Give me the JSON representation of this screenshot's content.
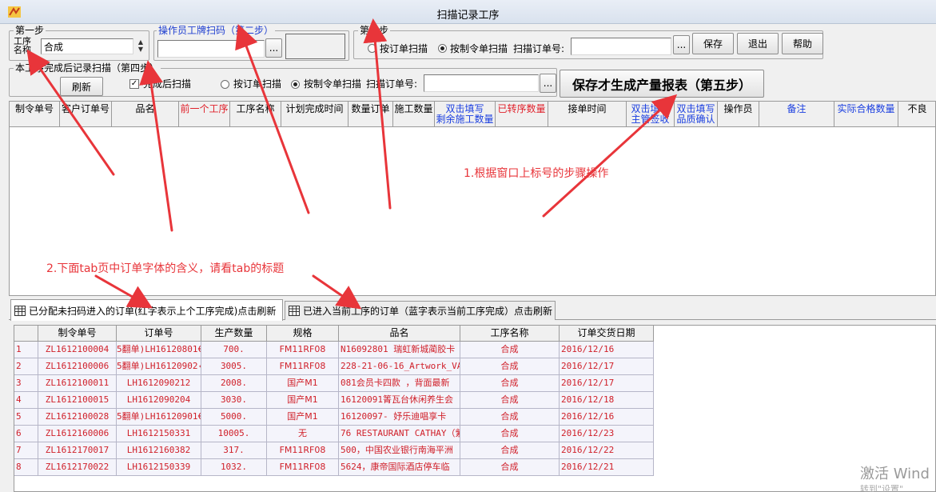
{
  "window": {
    "title": "扫描记录工序"
  },
  "step1": {
    "legend": "第一步",
    "process_label": "工序\n名称",
    "process_value": "合成"
  },
  "step2": {
    "legend": "操作员工牌扫码（第二步）",
    "browse": "..."
  },
  "step3": {
    "legend": "第三步",
    "radio_order": "按订单扫描",
    "radio_cmd": "按制令单扫描",
    "scan_label": "扫描订单号:",
    "browse": "...",
    "save": "保存",
    "exit": "退出",
    "help": "帮助"
  },
  "step4": {
    "legend": "本工序完成后记录扫描（第四步）",
    "refresh": "刷新",
    "check_after": "完成后扫描",
    "radio_order": "按订单扫描",
    "radio_cmd": "按制令单扫描",
    "scan_label": "扫描订单号:",
    "browse": "..."
  },
  "step5": {
    "save_report": "保存才生成产量报表（第五步）"
  },
  "top_grid": {
    "columns": [
      {
        "label": "制令单号",
        "color": "black"
      },
      {
        "label": "客户订单号",
        "color": "black"
      },
      {
        "label": "品名",
        "color": "black"
      },
      {
        "label": "前一个工序",
        "color": "red"
      },
      {
        "label": "工序名称",
        "color": "black"
      },
      {
        "label": "计划完成时间",
        "color": "black"
      },
      {
        "label": "数量订单",
        "color": "black"
      },
      {
        "label": "施工数量",
        "color": "black"
      },
      {
        "label": "双击填写\n剩余施工数量",
        "color": "blue"
      },
      {
        "label": "已转序数量",
        "color": "red"
      },
      {
        "label": "接单时间",
        "color": "black"
      },
      {
        "label": "双击填写\n主管签收",
        "color": "blue"
      },
      {
        "label": "双击填写\n品质确认",
        "color": "blue"
      },
      {
        "label": "操作员",
        "color": "black"
      },
      {
        "label": "备注",
        "color": "blue"
      },
      {
        "label": "实际合格数量",
        "color": "blue"
      },
      {
        "label": "不良",
        "color": "black"
      }
    ]
  },
  "notes": {
    "note1": "1.根据窗口上标号的步骤操作",
    "note2": "2.下面tab页中订单字体的含义，请看tab的标题"
  },
  "tabs": [
    {
      "label": "已分配未扫码进入的订单(红字表示上个工序完成)点击刷新",
      "active": true
    },
    {
      "label": "已进入当前工序的订单（蓝字表示当前工序完成）点击刷新",
      "active": false
    }
  ],
  "bottom_grid": {
    "columns": [
      "制令单号",
      "订单号",
      "生产数量",
      "规格",
      "品名",
      "工序名称",
      "订单交货日期"
    ],
    "rows": [
      {
        "idx": "1",
        "cmd": "ZL1612100004",
        "order": "5翻单)LH16120801€",
        "qty": "700.",
        "spec": "FM11RF08",
        "name": "N16092801 瑞虹新城蔺胶卡",
        "process": "合成",
        "date": "2016/12/16"
      },
      {
        "idx": "2",
        "cmd": "ZL1612100006",
        "order": "5翻单)LH16120902‹",
        "qty": "3005.",
        "spec": "FM11RF08",
        "name": "228-21-06-16_Artwork_VAGA",
        "process": "合成",
        "date": "2016/12/17"
      },
      {
        "idx": "3",
        "cmd": "ZL1612100011",
        "order": "LH1612090212",
        "qty": "2008.",
        "spec": "国产M1",
        "name": "081会员卡四款 ，背面最新",
        "process": "合成",
        "date": "2016/12/17"
      },
      {
        "idx": "4",
        "cmd": "ZL1612100015",
        "order": "LH1612090204",
        "qty": "3030.",
        "spec": "国产M1",
        "name": "16120091箐瓦台休闲养生会",
        "process": "合成",
        "date": "2016/12/18"
      },
      {
        "idx": "5",
        "cmd": "ZL1612100028",
        "order": "5翻单)LH16120901€",
        "qty": "5000.",
        "spec": "国产M1",
        "name": "16120097- 妤乐迪唱享卡",
        "process": "合成",
        "date": "2016/12/16"
      },
      {
        "idx": "6",
        "cmd": "ZL1612160006",
        "order": "LH1612150331",
        "qty": "10005.",
        "spec": "无",
        "name": "76 RESTAURANT CATHAY（紫",
        "process": "合成",
        "date": "2016/12/23"
      },
      {
        "idx": "7",
        "cmd": "ZL1612170017",
        "order": "LH1612160382",
        "qty": "317.",
        "spec": "FM11RF08",
        "name": "500，中国农业银行南海平洲",
        "process": "合成",
        "date": "2016/12/22"
      },
      {
        "idx": "8",
        "cmd": "ZL1612170022",
        "order": "LH1612150339",
        "qty": "1032.",
        "spec": "FM11RF08",
        "name": "5624，康帝国际酒店停车临",
        "process": "合成",
        "date": "2016/12/21"
      }
    ]
  },
  "watermark": {
    "line1": "激活 Wind",
    "line2": "转到\"设置\""
  },
  "colors": {
    "red_text": "#d0202a",
    "blue_text": "#1a3ee0",
    "annotation_red": "#e8353a"
  }
}
